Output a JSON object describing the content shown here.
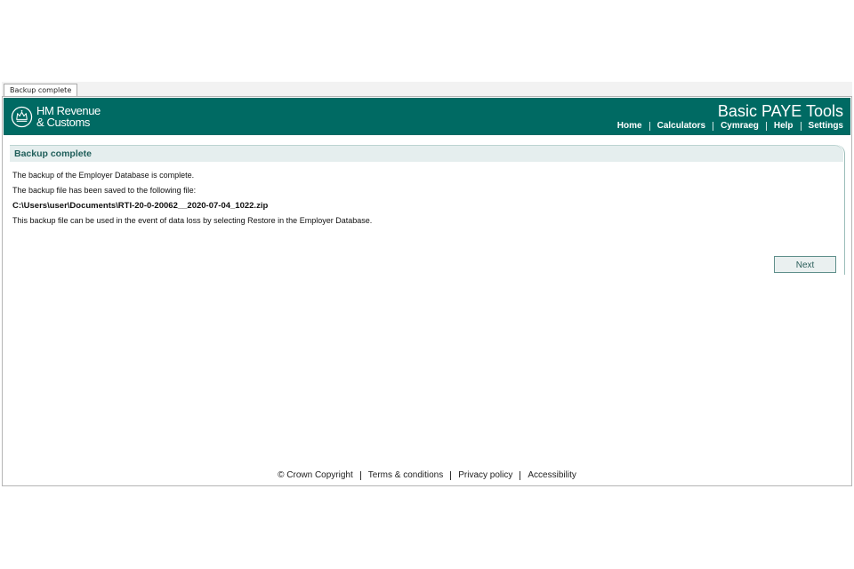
{
  "tab": {
    "label": "Backup complete"
  },
  "header": {
    "logo_line1": "HM Revenue",
    "logo_line2": "& Customs",
    "app_title": "Basic PAYE Tools",
    "nav": [
      "Home",
      "Calculators",
      "Cymraeg",
      "Help",
      "Settings"
    ],
    "brand_color": "#006a63"
  },
  "panel": {
    "title": "Backup complete",
    "lines": [
      "The backup of the Employer Database is complete.",
      "The backup file has been saved to the following file:",
      "C:\\Users\\user\\Documents\\RTI-20-0-20062__2020-07-04_1022.zip",
      "This backup file can be used in the event of data loss by selecting Restore in the Employer Database."
    ],
    "next_label": "Next"
  },
  "footer": {
    "copyright": "© Crown Copyright",
    "terms": "Terms & conditions",
    "privacy": "Privacy policy",
    "accessibility": "Accessibility"
  }
}
